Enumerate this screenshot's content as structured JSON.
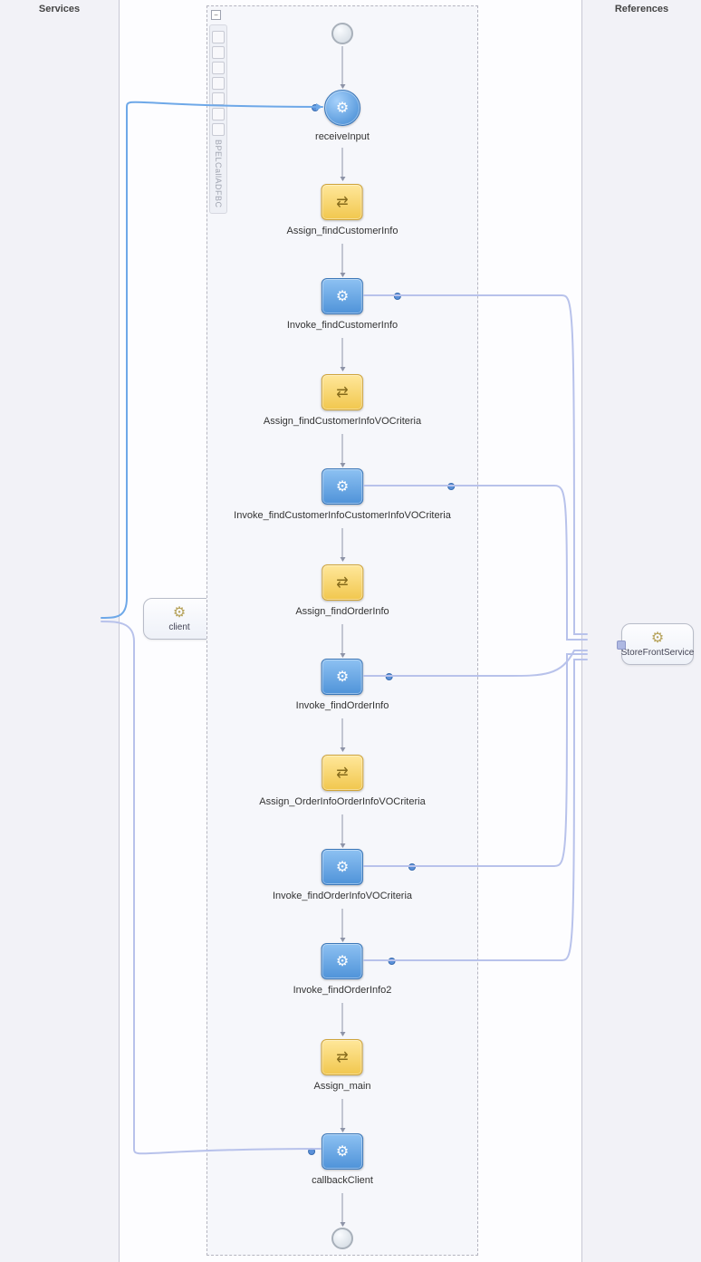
{
  "headers": {
    "services": "Services",
    "references": "References"
  },
  "services": {
    "client": {
      "label": "client"
    },
    "storefront": {
      "label": "StoreFrontService"
    }
  },
  "toolbar": {
    "label": "BPELCallADFBC"
  },
  "nodes": {
    "receiveInput": {
      "label": "receiveInput"
    },
    "assignFindCustomerInfo": {
      "label": "Assign_findCustomerInfo"
    },
    "invokeFindCustomerInfo": {
      "label": "Invoke_findCustomerInfo"
    },
    "assignFindCustomerInfoVOCriteria": {
      "label": "Assign_findCustomerInfoVOCriteria"
    },
    "invokeFindCustomerInfoCustomerInfoVOCriteria": {
      "label": "Invoke_findCustomerInfoCustomerInfoVOCriteria"
    },
    "assignFindOrderInfo": {
      "label": "Assign_findOrderInfo"
    },
    "invokeFindOrderInfo": {
      "label": "Invoke_findOrderInfo"
    },
    "assignOrderInfoOrderInfoVOCriteria": {
      "label": "Assign_OrderInfoOrderInfoVOCriteria"
    },
    "invokeFindOrderInfoVOCriteria": {
      "label": "Invoke_findOrderInfoVOCriteria"
    },
    "invokeFindOrderInfo2": {
      "label": "Invoke_findOrderInfo2"
    },
    "assignMain": {
      "label": "Assign_main"
    },
    "callbackClient": {
      "label": "callbackClient"
    }
  }
}
